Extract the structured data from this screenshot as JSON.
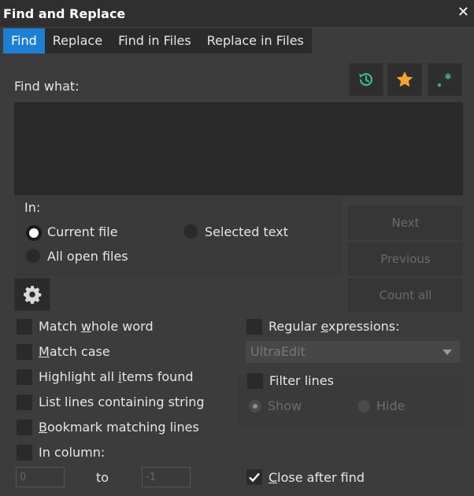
{
  "window": {
    "title": "Find and Replace",
    "close_glyph": "✕"
  },
  "tabs": [
    {
      "label": "Find",
      "active": true
    },
    {
      "label": "Replace",
      "active": false
    },
    {
      "label": "Find in Files",
      "active": false
    },
    {
      "label": "Replace in Files",
      "active": false
    }
  ],
  "find": {
    "label": "Find what:",
    "value": ""
  },
  "toolbar": {
    "history_icon": "history-icon",
    "favorites_icon": "star-icon",
    "regex_icon": "regex-icon"
  },
  "in_group": {
    "label": "In:",
    "current_file": "Current file",
    "selected_text": "Selected text",
    "all_open_files": "All open files",
    "selected": "current_file"
  },
  "actions": {
    "next": "Next",
    "previous": "Previous",
    "count_all": "Count all"
  },
  "options": {
    "match_whole_word": {
      "pre": "Match ",
      "ul": "w",
      "post": "hole word"
    },
    "match_case": {
      "pre": "",
      "ul": "M",
      "post": "atch case"
    },
    "highlight_all": {
      "pre": "Highlight all ",
      "ul": "i",
      "post": "tems found"
    },
    "list_lines": {
      "pre": "List lines containing string",
      "ul": "",
      "post": ""
    },
    "bookmark": {
      "pre": "",
      "ul": "B",
      "post": "ookmark matching lines"
    },
    "in_column": {
      "pre": "In column:",
      "ul": "",
      "post": ""
    }
  },
  "column": {
    "from": "0",
    "to_label": "to",
    "to": "-1"
  },
  "regex": {
    "pre": "Regular ",
    "ul": "e",
    "post": "xpressions:",
    "engine": "UltraEdit"
  },
  "filter": {
    "label": "Filter lines",
    "show": "Show",
    "hide": "Hide",
    "selected": "show"
  },
  "close_after_find": {
    "pre": "",
    "ul": "C",
    "post": "lose after find",
    "checked": true
  },
  "colors": {
    "accent": "#1e7fd2",
    "star": "#f2a531",
    "history": "#3fb68b",
    "regex": "#4aa784"
  }
}
